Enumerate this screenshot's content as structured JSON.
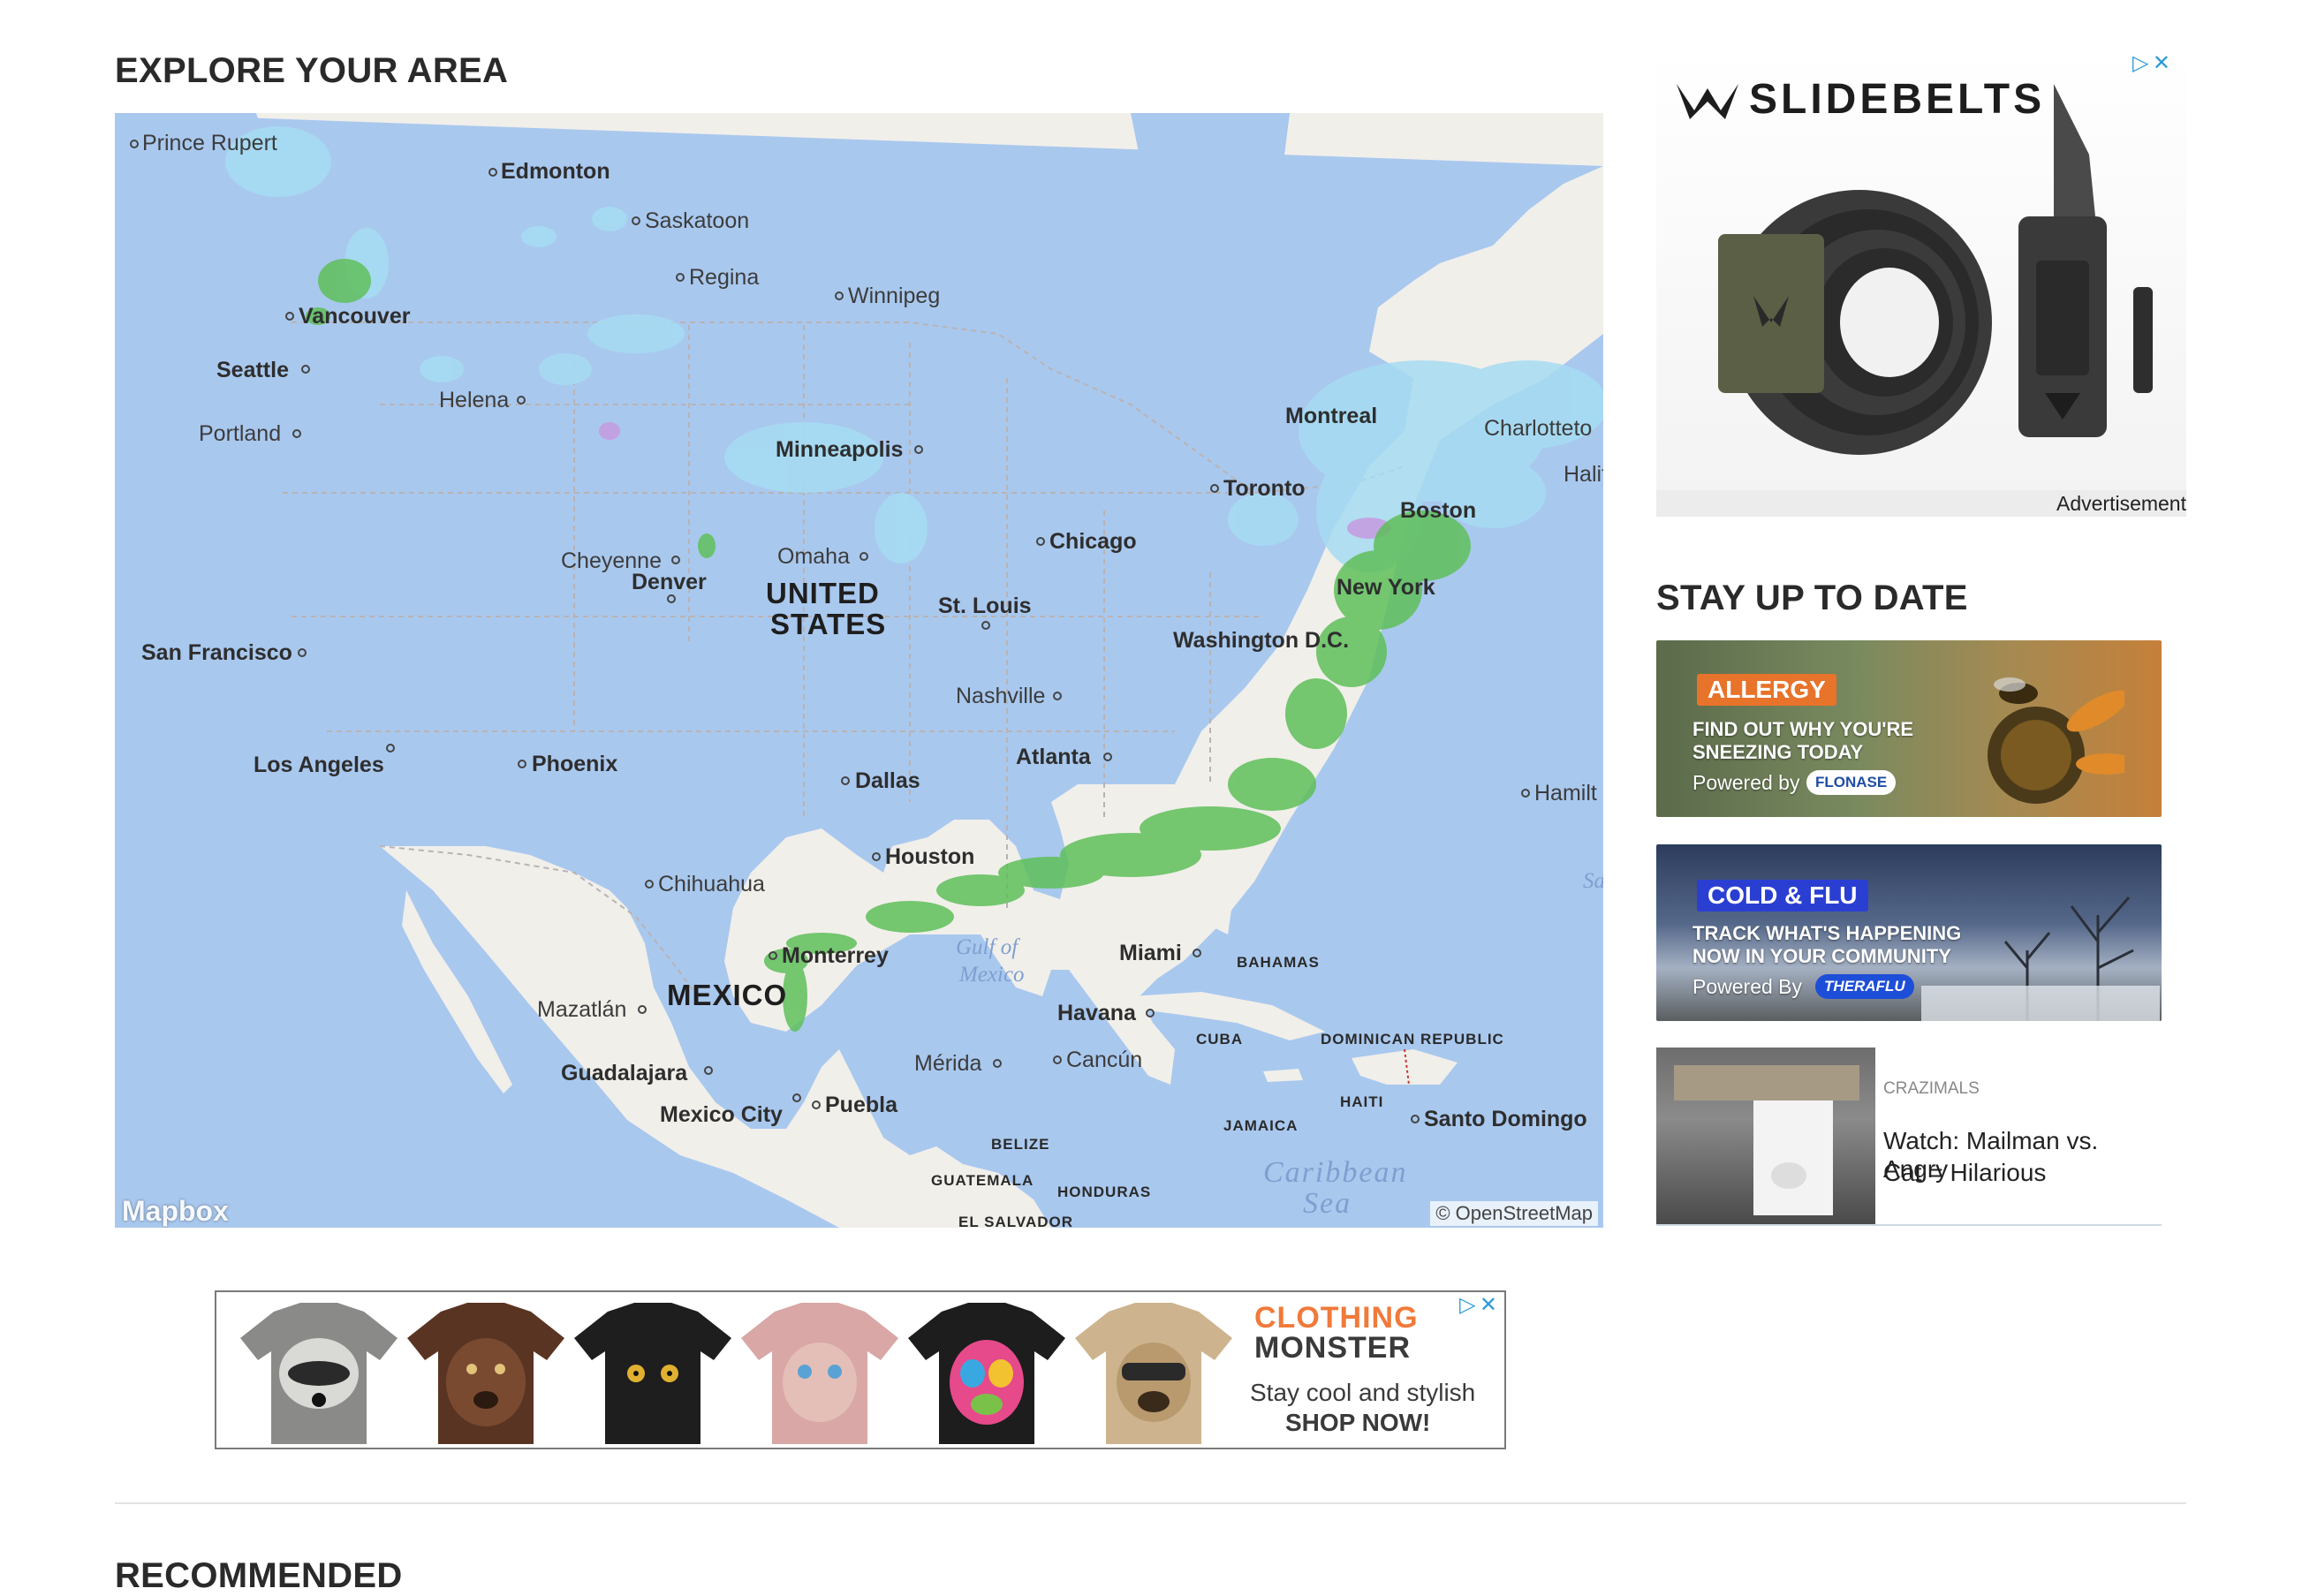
{
  "explore": {
    "title": "EXPLORE YOUR AREA",
    "map_logo": "Mapbox",
    "attribution": "© OpenStreetMap"
  },
  "map_labels": {
    "cities": [
      "Prince Rupert",
      "Edmonton",
      "Saskatoon",
      "Regina",
      "Winnipeg",
      "Vancouver",
      "Seattle",
      "Helena",
      "Portland",
      "Minneapolis",
      "Montreal",
      "Charlotteto",
      "Halif",
      "Toronto",
      "Boston",
      "Chicago",
      "Cheyenne",
      "Denver",
      "Omaha",
      "New York",
      "St. Louis",
      "Washington D.C.",
      "San Francisco",
      "Nashville",
      "Los Angeles",
      "Phoenix",
      "Atlanta",
      "Dallas",
      "Hamilt",
      "Houston",
      "Chihuahua",
      "Monterrey",
      "Miami",
      "Mazatlán",
      "Havana",
      "Mérida",
      "Cancún",
      "Guadalajara",
      "Mexico City",
      "Puebla",
      "Santo Domingo"
    ],
    "countries": [
      "UNITED",
      "STATES",
      "MEXICO"
    ],
    "small_countries": [
      "BAHAMAS",
      "CUBA",
      "DOMINICAN REPUBLIC",
      "HAITI",
      "JAMAICA",
      "BELIZE",
      "GUATEMALA",
      "HONDURAS",
      "EL SALVADOR"
    ],
    "seas": [
      "Gulf of",
      "Mexico",
      "Caribbean",
      "Sea",
      "Sa"
    ]
  },
  "ad_top": {
    "brand": "SLIDEBELTS",
    "label": "Advertisement",
    "adchoices_icon": "adchoices-icon",
    "close_icon": "close-icon"
  },
  "stay_up_to_date": {
    "title": "STAY UP TO DATE",
    "promos": [
      {
        "tag": "ALLERGY",
        "line1": "FIND OUT WHY YOU'RE",
        "line2": "SNEEZING TODAY",
        "powered": "Powered by",
        "sponsor": "FLONASE",
        "tag_color": "#e8732a"
      },
      {
        "tag": "COLD & FLU",
        "line1": "TRACK WHAT'S HAPPENING",
        "line2": "NOW IN YOUR COMMUNITY",
        "powered": "Powered By",
        "sponsor": "THERAFLU",
        "tag_color": "#2a3fd2"
      }
    ],
    "article": {
      "source": "CRAZIMALS",
      "title_line1": "Watch: Mailman vs. Angry",
      "title_line2": "Cat = Hilarious"
    }
  },
  "ad_bottom": {
    "brand_line1": "CLOTHING",
    "brand_line2": "MONSTER",
    "tagline": "Stay cool and stylish",
    "cta": "SHOP NOW!",
    "adchoices_icon": "adchoices-icon",
    "close_icon": "close-icon"
  },
  "recommended": {
    "title": "RECOMMENDED"
  },
  "colors": {
    "water": "#a9c8ee",
    "land": "#f1efea",
    "radar_rain": "#5fbf5a",
    "radar_snow": "#a6dcf2",
    "allergy_tag": "#e8732a",
    "cold_flu_tag": "#2a3fd2"
  }
}
